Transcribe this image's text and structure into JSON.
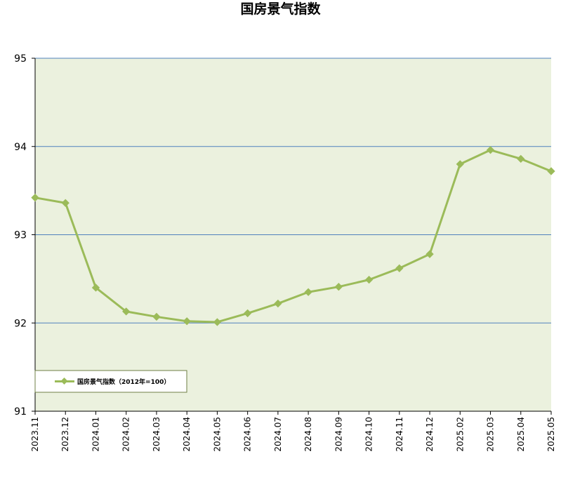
{
  "chart_data": {
    "type": "line",
    "title": "国房景气指数",
    "categories": [
      "2023.11",
      "2023.12",
      "2024.01",
      "2024.02",
      "2024.03",
      "2024.04",
      "2024.05",
      "2024.06",
      "2024.07",
      "2024.08",
      "2024.09",
      "2024.10",
      "2024.11",
      "2024.12",
      "2025.02",
      "2025.03",
      "2025.04",
      "2025.05"
    ],
    "series": [
      {
        "name": "国房景气指数（2012年=100）",
        "values": [
          93.42,
          93.36,
          92.4,
          92.13,
          92.07,
          92.02,
          92.01,
          92.11,
          92.22,
          92.35,
          92.41,
          92.49,
          92.62,
          92.78,
          93.8,
          93.96,
          93.86,
          93.72
        ]
      }
    ],
    "ylim": [
      91,
      95
    ],
    "yticks": [
      91,
      92,
      93,
      94,
      95
    ],
    "grid": true,
    "legend_position": "bottom-left",
    "colors": {
      "series": "#9bbb59",
      "plot_bg": "#ebf1de",
      "grid": "#4f81bd"
    }
  }
}
